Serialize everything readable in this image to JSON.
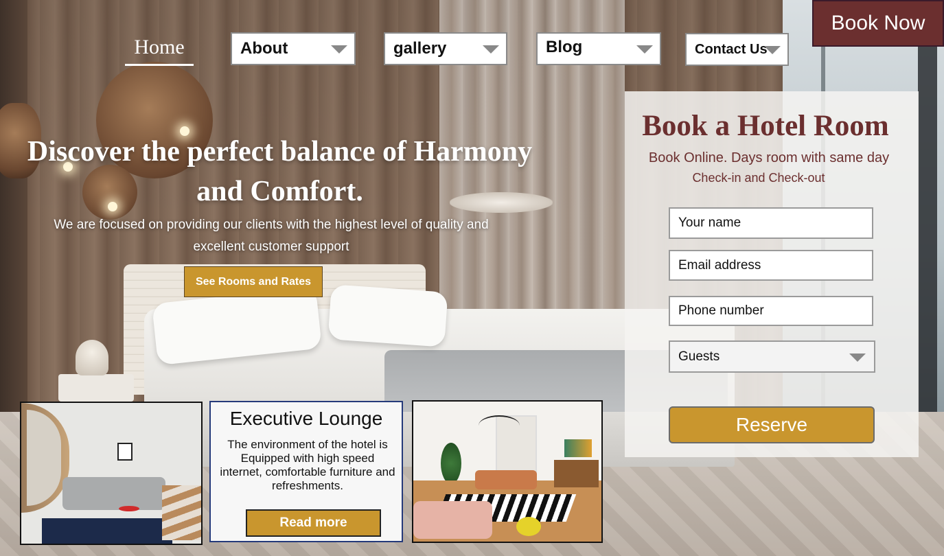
{
  "nav": {
    "home": "Home",
    "about": "About",
    "gallery": "gallery",
    "blog": "Blog",
    "contact": "Contact Us",
    "book_now": "Book Now"
  },
  "hero": {
    "title": "Discover the perfect balance of Harmony and Comfort.",
    "subtitle": "We are focused on providing our clients with the highest level of quality and excellent customer support",
    "cta": "See Rooms and Rates"
  },
  "booking": {
    "title": "Book a Hotel Room",
    "sub1": "Book Online. Days room with same day",
    "sub2": "Check-in and Check-out",
    "name_placeholder": "Your name",
    "email_placeholder": "Email address",
    "phone_placeholder": "Phone number",
    "guests_label": "Guests",
    "reserve": "Reserve"
  },
  "cards": {
    "lounge_title": "Executive Lounge",
    "lounge_text": "The environment of the hotel is Equipped with high speed internet, comfortable furniture and refreshments.",
    "read_more": "Read more"
  },
  "colors": {
    "accent_gold": "#c9962e",
    "brand_maroon": "#6b2f2f"
  }
}
